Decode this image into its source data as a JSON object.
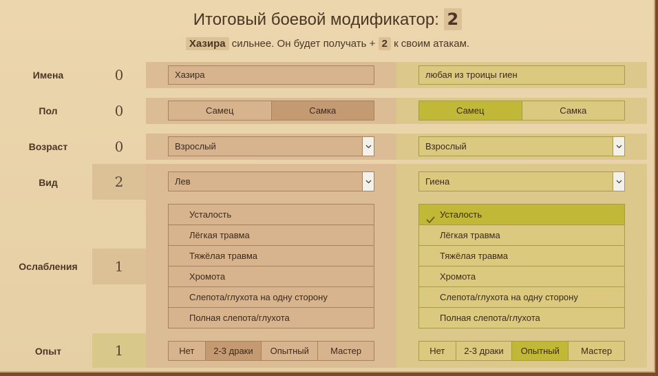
{
  "header": {
    "title_text": "Итоговый боевой модификатор:",
    "title_value": "2",
    "sub_name": "Хазира",
    "sub_text1": "сильнее. Он будет получать +",
    "sub_value": "2",
    "sub_text2": "к своим атакам."
  },
  "rows": {
    "names": {
      "label": "Имена",
      "score": "0",
      "left_value": "Хазира",
      "right_value": "любая из троицы гиен"
    },
    "sex": {
      "label": "Пол",
      "score": "0",
      "options": [
        "Самец",
        "Самка"
      ],
      "left_selected": 1,
      "right_selected": 0
    },
    "age": {
      "label": "Возраст",
      "score": "0",
      "left_value": "Взрослый",
      "right_value": "Взрослый"
    },
    "species": {
      "label": "Вид",
      "score": "2",
      "left_value": "Лев",
      "right_value": "Гиена"
    },
    "debuffs": {
      "label": "Ослабления",
      "score": "1",
      "items": [
        "Усталость",
        "Лёгкая травма",
        "Тяжёлая травма",
        "Хромота",
        "Слепота/глухота на одну сторону",
        "Полная слепота/глухота"
      ],
      "right_checked": [
        0
      ]
    },
    "experience": {
      "label": "Опыт",
      "score": "1",
      "options": [
        "Нет",
        "2-3 драки",
        "Опытный",
        "Мастер"
      ],
      "left_selected": 1,
      "right_selected": 2
    }
  },
  "icons": {
    "dropdown": "chevron-down-icon",
    "check": "check-icon"
  },
  "colors": {
    "left_selected": "#c49a72",
    "right_selected": "#c2b838"
  }
}
